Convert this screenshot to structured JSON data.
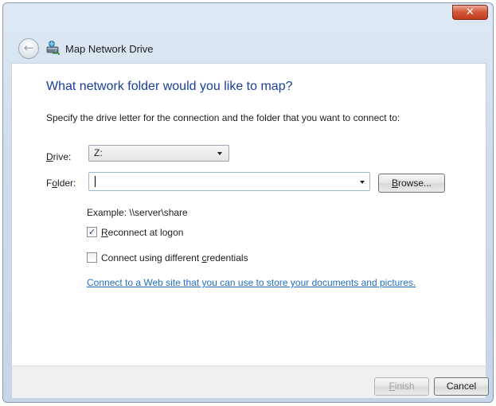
{
  "window": {
    "title": "Map Network Drive",
    "close_glyph": "✕",
    "back_glyph": "←",
    "accent_heading_color": "#1a3e9a",
    "link_color": "#1f6fc6",
    "close_color": "#c23b1e"
  },
  "main": {
    "heading": "What network folder would you like to map?",
    "instructions": "Specify the drive letter for the connection and the folder that you want to connect to:",
    "drive": {
      "label": "Drive:",
      "value": "Z:"
    },
    "folder": {
      "label": "Folder:",
      "value": "",
      "browse_label": "Browse..."
    },
    "example": "Example: \\\\server\\share",
    "reconnect": {
      "label": "Reconnect at logon",
      "checked": true,
      "check_glyph": "✓"
    },
    "credentials": {
      "label": "Connect using different credentials",
      "checked": false
    },
    "web_link": "Connect to a Web site that you can use to store your documents and pictures."
  },
  "footer": {
    "finish_label": "Finish",
    "cancel_label": "Cancel"
  },
  "icons": {
    "back": "back-arrow-icon",
    "network_drive": "network-drive-icon",
    "close": "close-icon",
    "dropdown": "chevron-down-icon",
    "checkbox": "checkmark-icon"
  }
}
